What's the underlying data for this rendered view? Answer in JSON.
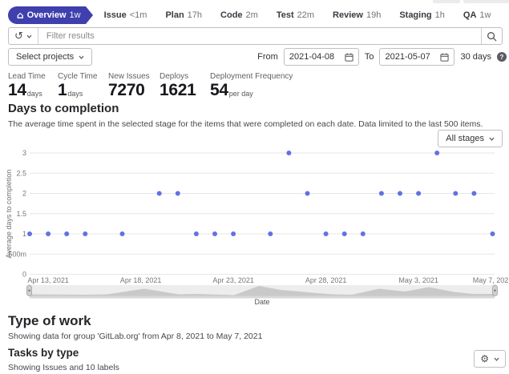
{
  "colors": {
    "accent_indigo": "#3f3fad",
    "point_blue": "#6172e3",
    "border_gray": "#bfbfc3"
  },
  "icons": [
    "home-icon",
    "history-icon",
    "chevron-down-icon",
    "search-icon",
    "calendar-icon",
    "question-icon",
    "gear-icon"
  ],
  "nav": {
    "overview": {
      "label": "Overview",
      "duration": "1w"
    },
    "stages": [
      {
        "label": "Issue",
        "duration": "<1m"
      },
      {
        "label": "Plan",
        "duration": "17h"
      },
      {
        "label": "Code",
        "duration": "2m"
      },
      {
        "label": "Test",
        "duration": "22m"
      },
      {
        "label": "Review",
        "duration": "19h"
      },
      {
        "label": "Staging",
        "duration": "1h"
      },
      {
        "label": "QA",
        "duration": "1w"
      }
    ]
  },
  "filter_bar": {
    "placeholder": "Filter results"
  },
  "controls": {
    "select_projects_label": "Select projects",
    "from_label": "From",
    "from_date": "2021-04-08",
    "to_label": "To",
    "to_date": "2021-05-07",
    "range_label": "30 days",
    "help_glyph": "?"
  },
  "metrics": [
    {
      "label": "Lead Time",
      "value": "14",
      "unit": "days"
    },
    {
      "label": "Cycle Time",
      "value": "1",
      "unit": "days"
    },
    {
      "label": "New Issues",
      "value": "7270",
      "unit": ""
    },
    {
      "label": "Deploys",
      "value": "1621",
      "unit": ""
    },
    {
      "label": "Deployment Frequency",
      "value": "54",
      "unit": "per day"
    }
  ],
  "days_to_completion": {
    "title": "Days to completion",
    "description": "The average time spent in the selected stage for the items that were completed on each date. Data limited to the last 500 items.",
    "stage_filter_label": "All stages"
  },
  "chart_data": {
    "type": "scatter",
    "title": "Days to completion",
    "xlabel": "Date",
    "ylabel": "Average days to completion",
    "grid": true,
    "legend": "none",
    "point_color": "#6172e3",
    "y_axis": {
      "min": 0,
      "max": 3,
      "ticks": [
        {
          "label": "0",
          "value": 0
        },
        {
          "label": "500m",
          "value": 0.5
        },
        {
          "label": "1",
          "value": 1
        },
        {
          "label": "1.5",
          "value": 1.5
        },
        {
          "label": "2",
          "value": 2
        },
        {
          "label": "2.5",
          "value": 2.5
        },
        {
          "label": "3",
          "value": 3
        }
      ]
    },
    "x_axis": {
      "start_date": "Apr 12, 2021",
      "end_date": "May 7, 2021",
      "total_days": 25,
      "ticks": [
        {
          "label": "Apr 13, 2021",
          "day": 1
        },
        {
          "label": "Apr 18, 2021",
          "day": 6
        },
        {
          "label": "Apr 23, 2021",
          "day": 11
        },
        {
          "label": "Apr 28, 2021",
          "day": 16
        },
        {
          "label": "May 3, 2021",
          "day": 21
        },
        {
          "label": "May 7, 2021",
          "day": 25
        }
      ]
    },
    "points": [
      {
        "date": "Apr 12, 2021",
        "day": 0,
        "value": 1
      },
      {
        "date": "Apr 13, 2021",
        "day": 1,
        "value": 1
      },
      {
        "date": "Apr 14, 2021",
        "day": 2,
        "value": 1
      },
      {
        "date": "Apr 15, 2021",
        "day": 3,
        "value": 1
      },
      {
        "date": "Apr 17, 2021",
        "day": 5,
        "value": 1
      },
      {
        "date": "Apr 19, 2021",
        "day": 7,
        "value": 2
      },
      {
        "date": "Apr 20, 2021",
        "day": 8,
        "value": 2
      },
      {
        "date": "Apr 21, 2021",
        "day": 9,
        "value": 1
      },
      {
        "date": "Apr 22, 2021",
        "day": 10,
        "value": 1
      },
      {
        "date": "Apr 23, 2021",
        "day": 11,
        "value": 1
      },
      {
        "date": "Apr 25, 2021",
        "day": 13,
        "value": 1
      },
      {
        "date": "Apr 26, 2021",
        "day": 14,
        "value": 3
      },
      {
        "date": "Apr 27, 2021",
        "day": 15,
        "value": 2
      },
      {
        "date": "Apr 28, 2021",
        "day": 16,
        "value": 1
      },
      {
        "date": "Apr 29, 2021",
        "day": 17,
        "value": 1
      },
      {
        "date": "Apr 30, 2021",
        "day": 18,
        "value": 1
      },
      {
        "date": "May 1, 2021",
        "day": 19,
        "value": 2
      },
      {
        "date": "May 2, 2021",
        "day": 20,
        "value": 2
      },
      {
        "date": "May 3, 2021",
        "day": 21,
        "value": 2
      },
      {
        "date": "May 4, 2021",
        "day": 22,
        "value": 3
      },
      {
        "date": "May 5, 2021",
        "day": 23,
        "value": 2
      },
      {
        "date": "May 6, 2021",
        "day": 24,
        "value": 2
      },
      {
        "date": "May 7, 2021",
        "day": 25,
        "value": 1
      }
    ]
  },
  "type_of_work": {
    "title": "Type of work",
    "subtitle": "Showing data for group 'GitLab.org' from Apr 8, 2021 to May 7, 2021"
  },
  "tasks_by_type": {
    "title": "Tasks by type",
    "subtitle": "Showing Issues and 10 labels"
  }
}
